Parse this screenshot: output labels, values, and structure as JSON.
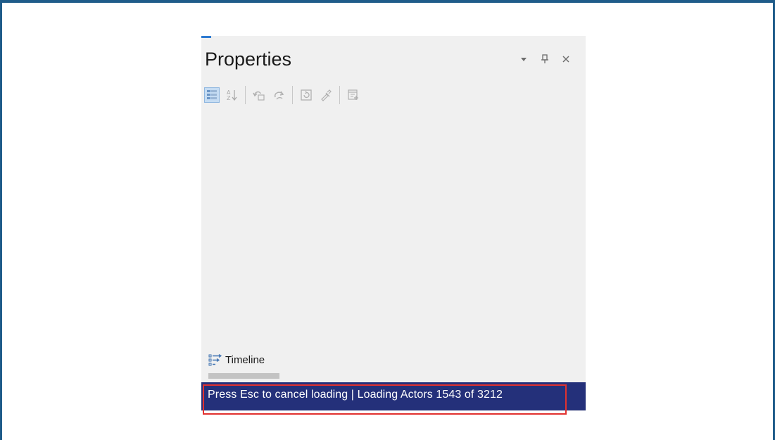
{
  "panel": {
    "title": "Properties",
    "title_buttons": [
      {
        "icon": "dropdown-arrow-icon",
        "glyph": "▾"
      },
      {
        "icon": "pin-icon",
        "glyph": "⊥"
      },
      {
        "icon": "close-icon",
        "glyph": "✕"
      }
    ],
    "toolbar": [
      {
        "icon": "categorized-view-icon",
        "active": true
      },
      {
        "icon": "alphabetical-sort-icon",
        "active": false
      },
      {
        "separator": true
      },
      {
        "icon": "undo-icon",
        "active": false
      },
      {
        "icon": "redo-icon",
        "active": false
      },
      {
        "separator": true
      },
      {
        "icon": "reset-icon",
        "active": false
      },
      {
        "icon": "eyedropper-icon",
        "active": false
      },
      {
        "separator": true
      },
      {
        "icon": "add-property-icon",
        "active": false
      }
    ],
    "timeline_label": "Timeline"
  },
  "status": {
    "text": "Press Esc to cancel loading | Loading Actors 1543 of 3212",
    "loaded": 1543,
    "total": 3212
  },
  "colors": {
    "frame_border": "#1f5c8a",
    "panel_bg": "#f0f0f0",
    "status_bg": "#24307a",
    "highlight": "#e1312f",
    "accent": "#2e7bd1"
  }
}
